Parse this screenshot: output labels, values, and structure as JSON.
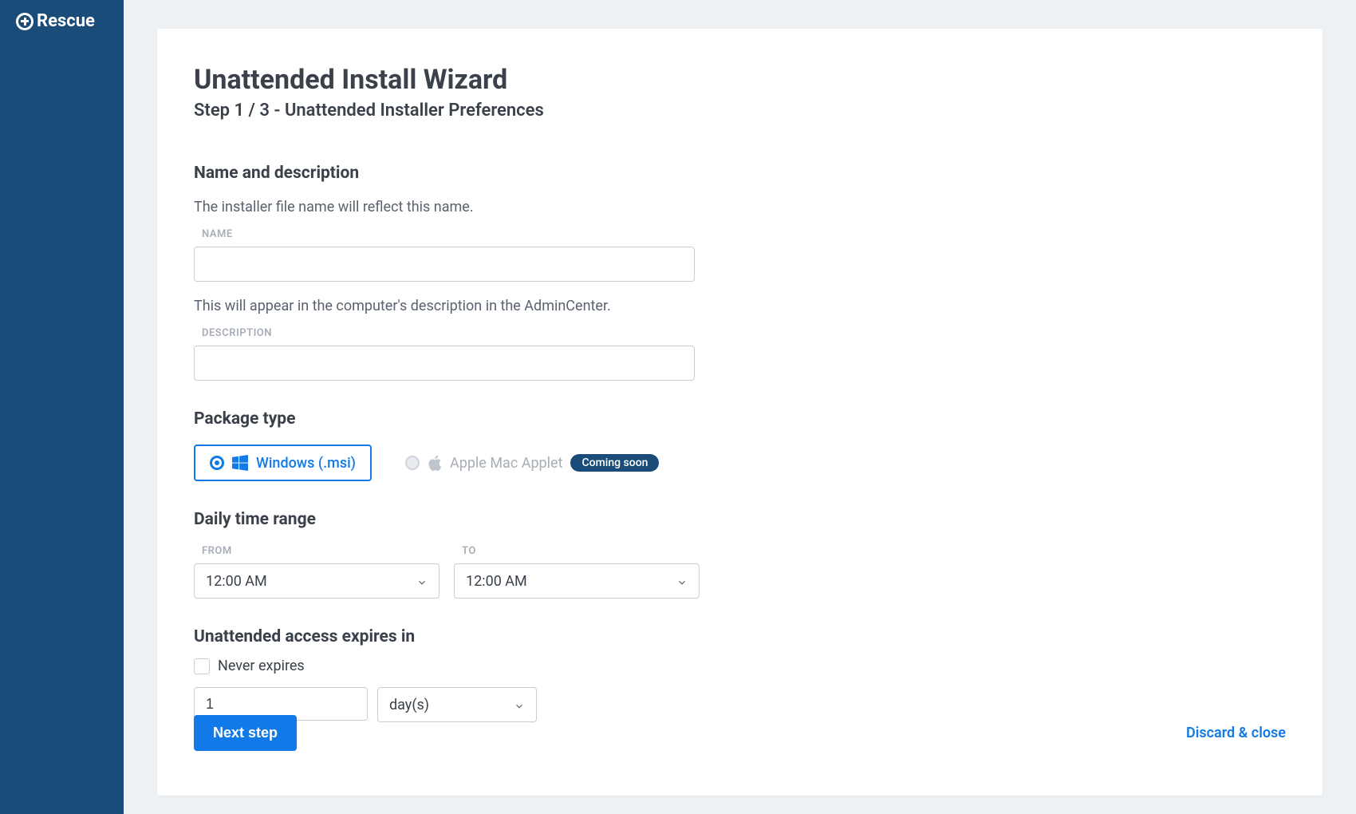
{
  "brand": "Rescue",
  "wizard": {
    "title": "Unattended Install Wizard",
    "step": "Step 1 / 3 - Unattended Installer Preferences"
  },
  "sections": {
    "name_desc": {
      "heading": "Name and description",
      "name_help": "The installer file name will reflect this name.",
      "name_label": "NAME",
      "name_value": "",
      "desc_help": "This will appear in the computer's description in the AdminCenter.",
      "desc_label": "DESCRIPTION",
      "desc_value": ""
    },
    "package": {
      "heading": "Package type",
      "windows_label": "Windows (.msi)",
      "mac_label": "Apple Mac Applet",
      "coming_soon": "Coming soon"
    },
    "time_range": {
      "heading": "Daily time range",
      "from_label": "FROM",
      "to_label": "TO",
      "from_value": "12:00 AM",
      "to_value": "12:00 AM"
    },
    "expires": {
      "heading": "Unattended access expires in",
      "never_label": "Never expires",
      "count": "1",
      "unit": "day(s)"
    }
  },
  "footer": {
    "next": "Next step",
    "discard": "Discard & close"
  }
}
